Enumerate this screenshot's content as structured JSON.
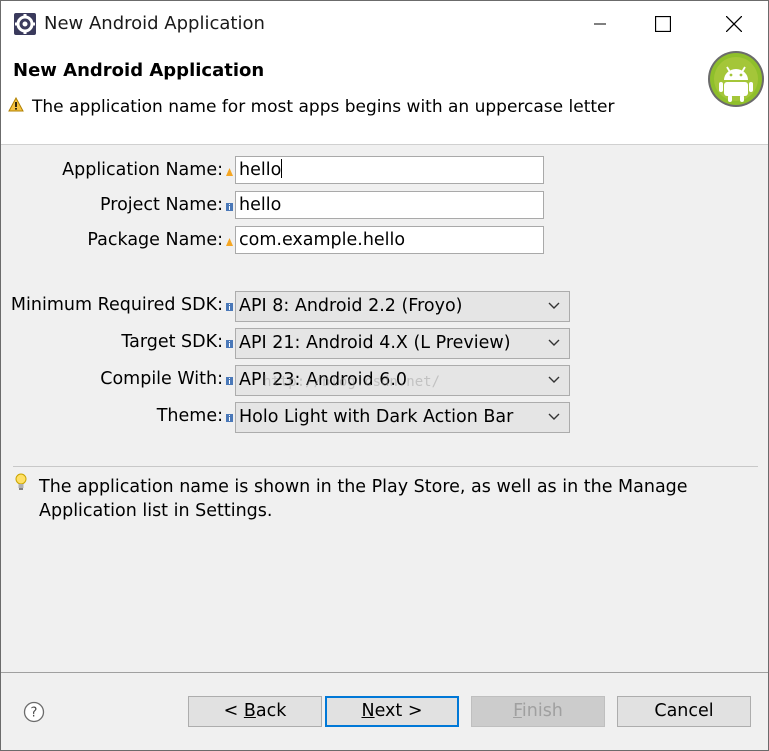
{
  "window": {
    "title": "New Android Application"
  },
  "header": {
    "title": "New Android Application",
    "message": "The application name for most apps begins with an uppercase letter"
  },
  "form": {
    "application_name": {
      "label": "Application Name:",
      "value": "hello"
    },
    "project_name": {
      "label": "Project Name:",
      "value": "hello"
    },
    "package_name": {
      "label": "Package Name:",
      "value": "com.example.hello"
    },
    "min_sdk": {
      "label": "Minimum Required SDK:",
      "value": "API 8: Android 2.2 (Froyo)"
    },
    "target_sdk": {
      "label": "Target SDK:",
      "value": "API 21: Android 4.X (L Preview)"
    },
    "compile_with": {
      "label": "Compile With:",
      "value": "API 23: Android 6.0"
    },
    "theme": {
      "label": "Theme:",
      "value": "Holo Light with Dark Action Bar"
    }
  },
  "watermark": "http://blog.csdn.net/",
  "help_text": "The application name is shown in the Play Store, as well as in the Manage Application list in Settings.",
  "buttons": {
    "back": {
      "prefix": "< ",
      "mnemonic": "B",
      "rest": "ack"
    },
    "next": {
      "mnemonic": "N",
      "rest": "ext >"
    },
    "finish": {
      "mnemonic": "F",
      "rest": "inish"
    },
    "cancel": "Cancel"
  },
  "colors": {
    "default_button_border": "#0078d7",
    "android_green": "#a4c639",
    "warning_yellow": "#f5c242"
  }
}
